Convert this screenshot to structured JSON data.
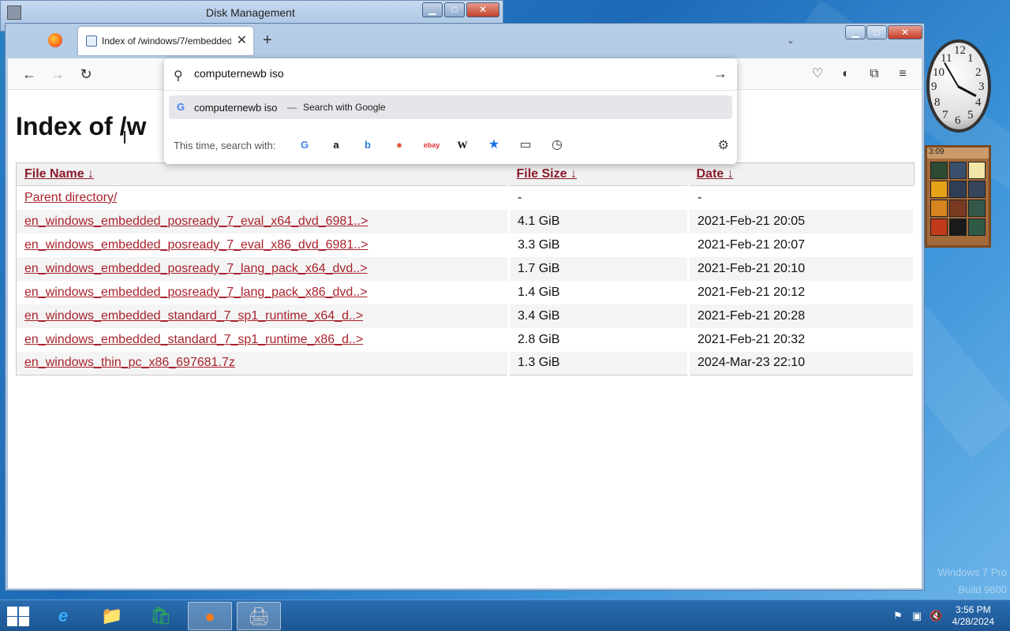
{
  "desktop": {
    "watermark_line1": "Windows 7 Pro",
    "watermark_line2": "Build 9600"
  },
  "disk_management": {
    "title": "Disk Management",
    "minimize": "▁",
    "maximize": "□",
    "close": "✕"
  },
  "browser": {
    "tab": {
      "title": "Index of /windows/7/embedded",
      "close": "✕"
    },
    "new_tab": "+",
    "tab_list": "⌄",
    "controls": {
      "minimize": "▁",
      "maximize": "□",
      "close": "✕"
    },
    "nav": {
      "back": "←",
      "forward": "→",
      "reload": "↻"
    },
    "url": {
      "value": "computernewb iso",
      "go": "→",
      "suggestion_text": "computernewb iso",
      "suggestion_dash": "—",
      "suggestion_action": "Search with Google",
      "onetime_label": "This time, search with:",
      "engines": [
        {
          "name": "google",
          "glyph": "G",
          "color": "#4285f4"
        },
        {
          "name": "amazon",
          "glyph": "a",
          "color": "#111111"
        },
        {
          "name": "bing",
          "glyph": "b",
          "color": "#2b7bd9"
        },
        {
          "name": "duckduckgo",
          "glyph": "●",
          "color": "#de5833"
        },
        {
          "name": "ebay",
          "glyph": "ebay",
          "color": "#e53238"
        },
        {
          "name": "wikipedia",
          "glyph": "W",
          "color": "#111111"
        },
        {
          "name": "bookmarks",
          "glyph": "★",
          "color": "#1a73e8"
        },
        {
          "name": "tabs",
          "glyph": "▭",
          "color": "#333333"
        },
        {
          "name": "history",
          "glyph": "◷",
          "color": "#333333"
        }
      ]
    },
    "toolbar": {
      "pocket": "♡",
      "account": "◐",
      "extensions": "⧉",
      "menu": "≡"
    }
  },
  "page": {
    "title": "Index of /w",
    "columns": [
      "File Name",
      "File Size",
      "Date"
    ],
    "sort_arrow": "↓",
    "rows": [
      {
        "name": "Parent directory/",
        "size": "-",
        "date": "-"
      },
      {
        "name": "en_windows_embedded_posready_7_eval_x64_dvd_6981..>",
        "size": "4.1 GiB",
        "date": "2021-Feb-21 20:05"
      },
      {
        "name": "en_windows_embedded_posready_7_eval_x86_dvd_6981..>",
        "size": "3.3 GiB",
        "date": "2021-Feb-21 20:07"
      },
      {
        "name": "en_windows_embedded_posready_7_lang_pack_x64_dvd..>",
        "size": "1.7 GiB",
        "date": "2021-Feb-21 20:10"
      },
      {
        "name": "en_windows_embedded_posready_7_lang_pack_x86_dvd..>",
        "size": "1.4 GiB",
        "date": "2021-Feb-21 20:12"
      },
      {
        "name": "en_windows_embedded_standard_7_sp1_runtime_x64_d..>",
        "size": "3.4 GiB",
        "date": "2021-Feb-21 20:28"
      },
      {
        "name": "en_windows_embedded_standard_7_sp1_runtime_x86_d..>",
        "size": "2.8 GiB",
        "date": "2021-Feb-21 20:32"
      },
      {
        "name": "en_windows_thin_pc_x86_697681.7z",
        "size": "1.3 GiB",
        "date": "2024-Mar-23 22:10"
      }
    ]
  },
  "gadgets": {
    "clock_numbers": [
      "12",
      "1",
      "2",
      "3",
      "4",
      "5",
      "6",
      "7",
      "8",
      "9",
      "10",
      "11"
    ],
    "puzzle_time": "3:09"
  },
  "taskbar": {
    "time": "3:56 PM",
    "date": "4/28/2024"
  }
}
